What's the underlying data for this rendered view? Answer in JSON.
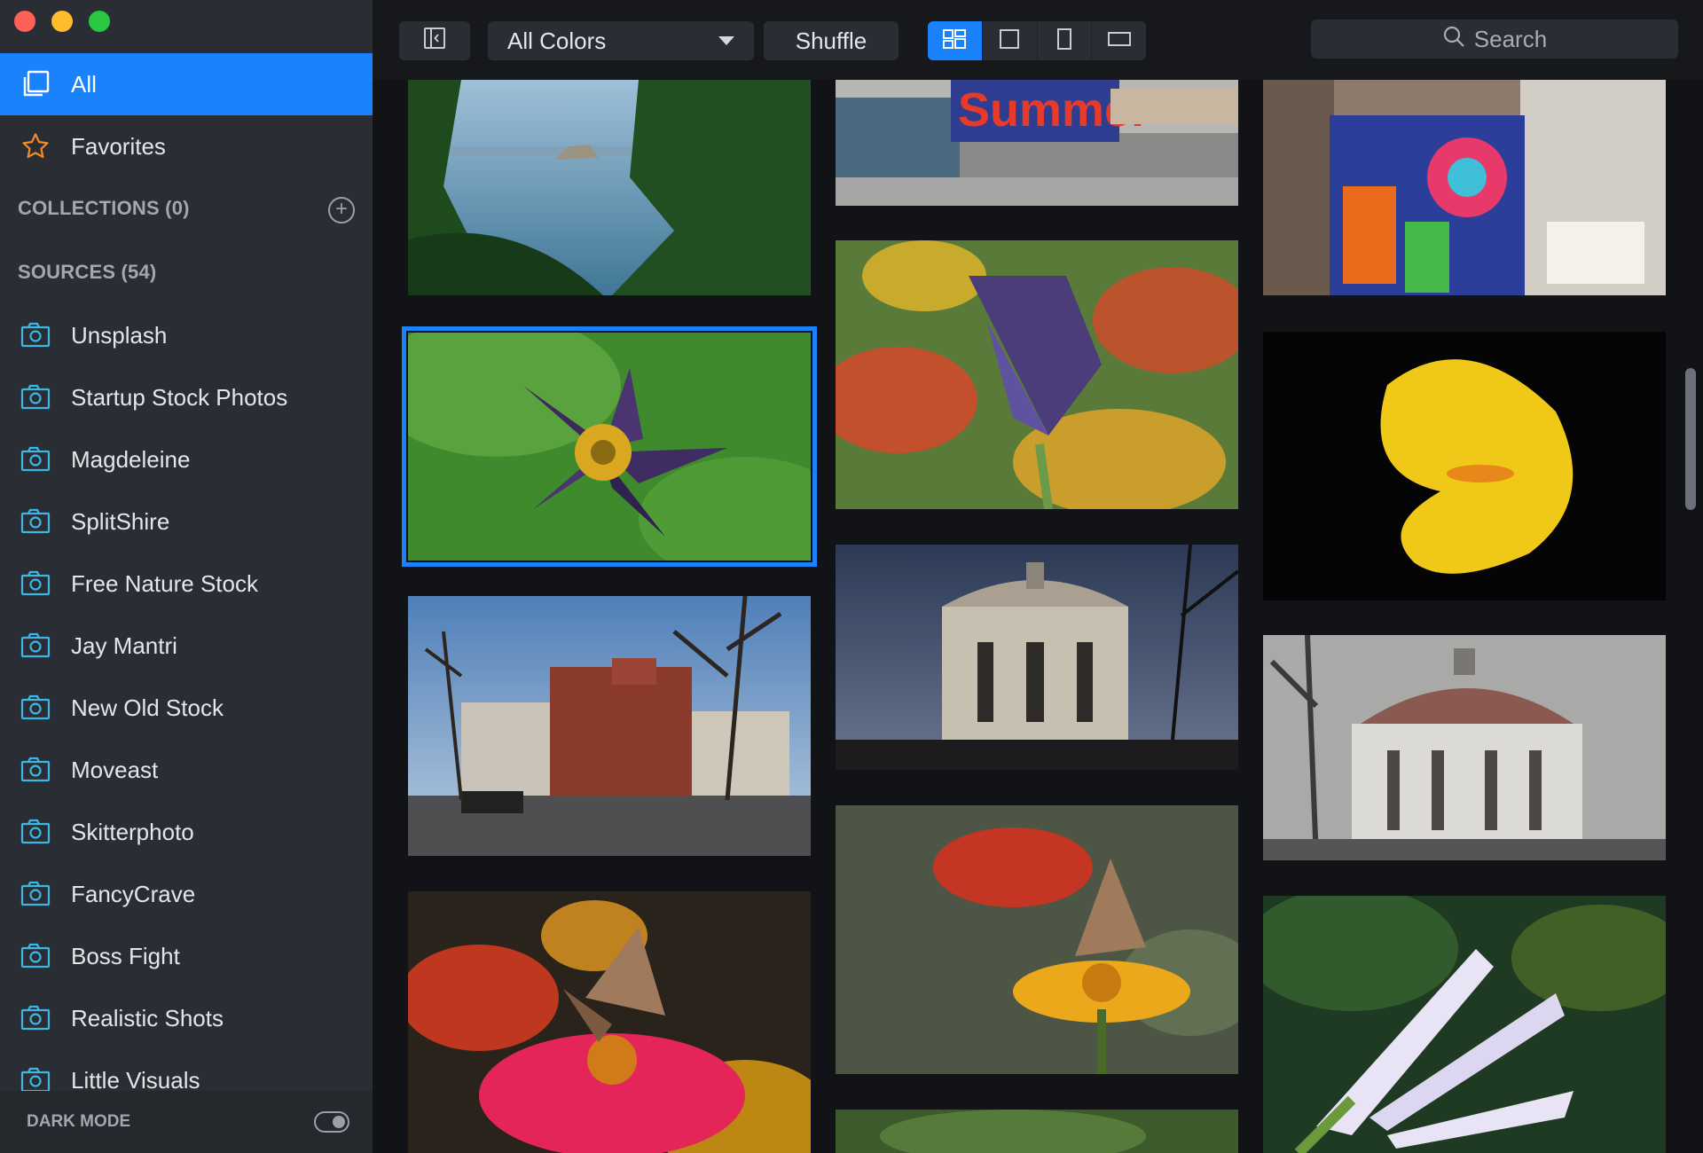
{
  "sidebar": {
    "all_label": "All",
    "favorites_label": "Favorites",
    "collections_label": "COLLECTIONS (0)",
    "sources_label": "SOURCES (54)",
    "sources": [
      "Unsplash",
      "Startup Stock Photos",
      "Magdeleine",
      "SplitShire",
      "Free Nature Stock",
      "Jay Mantri",
      "New Old Stock",
      "Moveast",
      "Skitterphoto",
      "FancyCrave",
      "Boss Fight",
      "Realistic Shots",
      "Little Visuals"
    ],
    "dark_mode_label": "DARK MODE",
    "dark_mode_on": true
  },
  "toolbar": {
    "color_filter": "All Colors",
    "shuffle_label": "Shuffle",
    "view_modes": [
      "mosaic",
      "square",
      "portrait",
      "landscape"
    ],
    "active_view": "mosaic",
    "search_placeholder": "Search"
  },
  "colors": {
    "accent": "#1a82fb",
    "sidebar_bg": "#2a2d33",
    "content_bg": "#121316"
  }
}
